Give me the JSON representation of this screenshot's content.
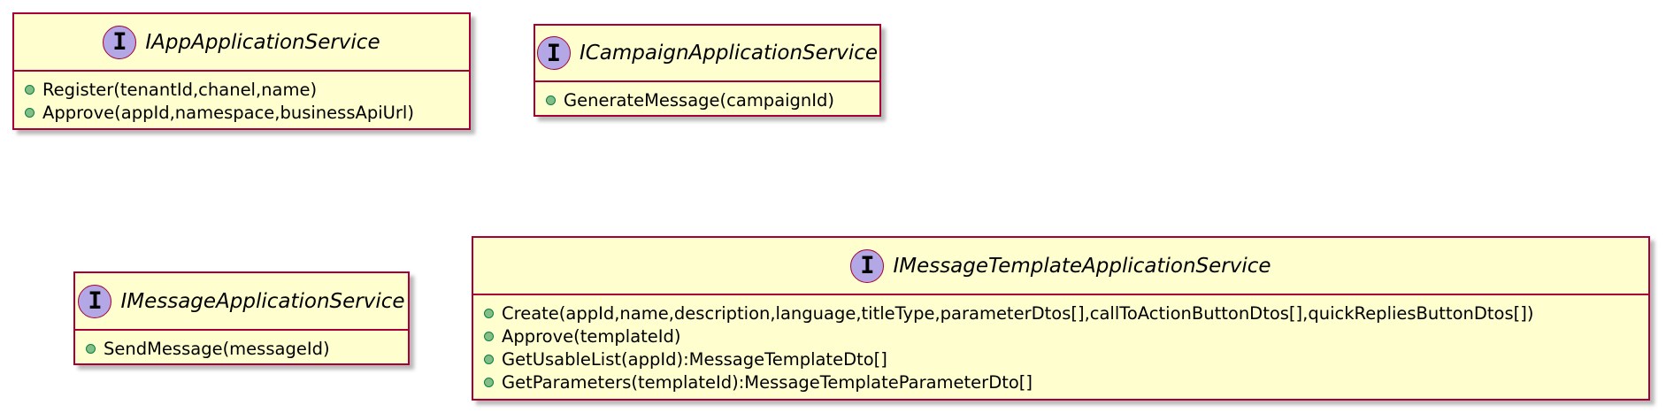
{
  "diagram": {
    "interfaces": [
      {
        "stereotype": "I",
        "name": "IAppApplicationService",
        "members": [
          "Register(tenantId,chanel,name)",
          "Approve(appId,namespace,businessApiUrl)"
        ]
      },
      {
        "stereotype": "I",
        "name": "ICampaignApplicationService",
        "members": [
          "GenerateMessage(campaignId)"
        ]
      },
      {
        "stereotype": "I",
        "name": "IMessageApplicationService",
        "members": [
          "SendMessage(messageId)"
        ]
      },
      {
        "stereotype": "I",
        "name": "IMessageTemplateApplicationService",
        "members": [
          "Create(appId,name,description,language,titleType,parameterDtos[],callToActionButtonDtos[],quickRepliesButtonDtos[])",
          "Approve(templateId)",
          "GetUsableList(appId):MessageTemplateDto[]",
          "GetParameters(templateId):MessageTemplateParameterDto[]"
        ]
      }
    ],
    "colors": {
      "class_background": "#fefece",
      "class_border": "#a80036",
      "interface_badge": "#b4a7e5",
      "public_member_icon": "#84be84",
      "public_member_icon_border": "#038048"
    },
    "icons": {
      "stereotype_badge": "interface-circle-icon",
      "member_visibility": "public-method-icon"
    }
  }
}
